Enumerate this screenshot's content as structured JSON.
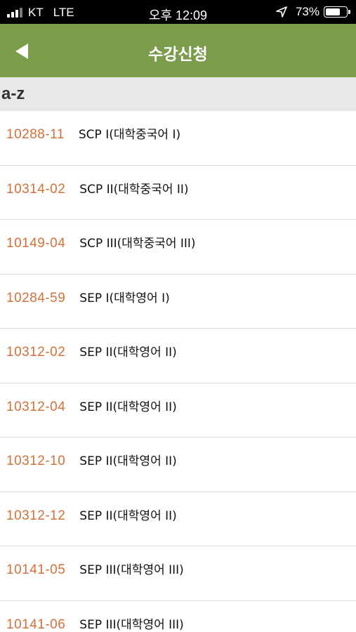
{
  "status_bar": {
    "carrier": "KT",
    "network": "LTE",
    "time": "오후 12:09",
    "battery": "73%",
    "battery_level": 0.73,
    "icons": [
      "signal-icon",
      "location-arrow-icon",
      "battery-icon"
    ]
  },
  "nav": {
    "title": "수강신청",
    "back_icon": "back-arrow-icon",
    "color": "#7b9c4b"
  },
  "section": {
    "header": "a-z"
  },
  "courses": [
    {
      "code": "10288-11",
      "name": "SCP I(대학중국어 I)"
    },
    {
      "code": "10314-02",
      "name": "SCP II(대학중국어 II)"
    },
    {
      "code": "10149-04",
      "name": "SCP III(대학중국어 III)"
    },
    {
      "code": "10284-59",
      "name": "SEP I(대학영어 I)"
    },
    {
      "code": "10312-02",
      "name": "SEP II(대학영어 II)"
    },
    {
      "code": "10312-04",
      "name": "SEP II(대학영어 II)"
    },
    {
      "code": "10312-10",
      "name": "SEP II(대학영어 II)"
    },
    {
      "code": "10312-12",
      "name": "SEP II(대학영어 II)"
    },
    {
      "code": "10141-05",
      "name": "SEP III(대학영어 III)"
    },
    {
      "code": "10141-06",
      "name": "SEP III(대학영어 III)"
    }
  ],
  "colors": {
    "code_text": "#d2703a",
    "section_bg": "#e8e8e8"
  }
}
